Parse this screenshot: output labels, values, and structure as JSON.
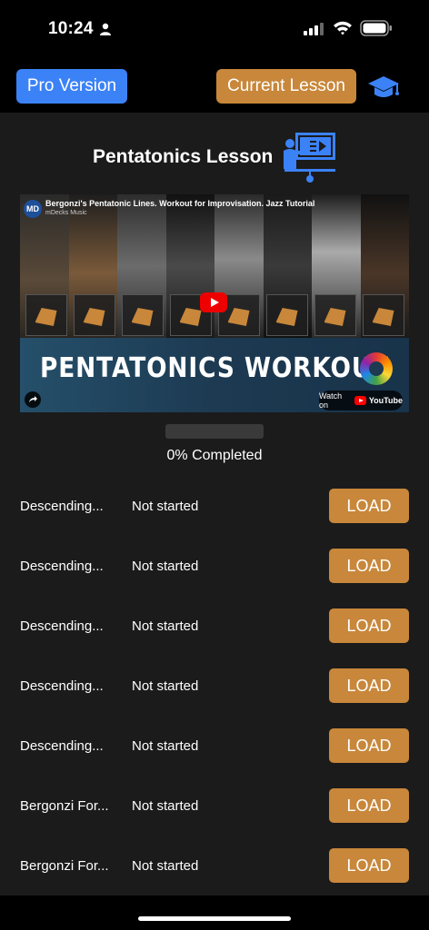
{
  "status_bar": {
    "time": "10:24",
    "icons": [
      "person-icon",
      "signal-icon",
      "wifi-icon",
      "battery-icon"
    ]
  },
  "header": {
    "pro_label": "Pro Version",
    "current_label": "Current Lesson",
    "icon": "graduation-cap-icon"
  },
  "lesson": {
    "title": "Pentatonics Lesson",
    "icon": "presentation-icon"
  },
  "video": {
    "channel_logo": "MD",
    "title": "Bergonzi's Pentatonic Lines. Workout for Improvisation. Jazz Tutorial",
    "channel": "mDecks Music",
    "banner": "PENTATONICS WORKOUT",
    "watch_on": "Watch on",
    "youtube": "YouTube"
  },
  "progress": {
    "label": "0% Completed",
    "fraction": 0
  },
  "exercises": [
    {
      "name": "Descending...",
      "status": "Not started",
      "action": "LOAD"
    },
    {
      "name": "Descending...",
      "status": "Not started",
      "action": "LOAD"
    },
    {
      "name": "Descending...",
      "status": "Not started",
      "action": "LOAD"
    },
    {
      "name": "Descending...",
      "status": "Not started",
      "action": "LOAD"
    },
    {
      "name": "Descending...",
      "status": "Not started",
      "action": "LOAD"
    },
    {
      "name": "Bergonzi For...",
      "status": "Not started",
      "action": "LOAD"
    },
    {
      "name": "Bergonzi For...",
      "status": "Not started",
      "action": "LOAD"
    }
  ],
  "colors": {
    "pro_button": "#3b82f6",
    "accent": "#c8873a",
    "background": "#1b1b1b"
  }
}
